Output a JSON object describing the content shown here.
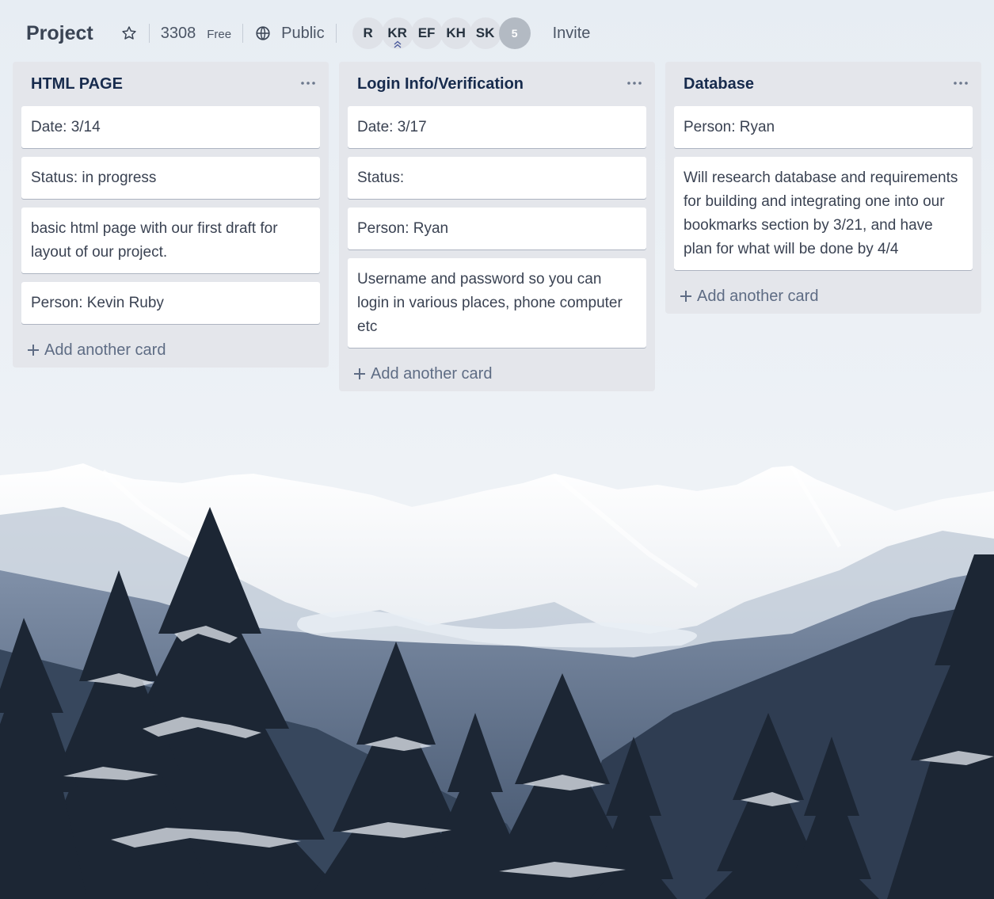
{
  "board": {
    "title": "Project",
    "team_name": "3308",
    "team_plan": "Free",
    "visibility": "Public",
    "invite_label": "Invite",
    "members": [
      "R",
      "KR",
      "EF",
      "KH",
      "SK"
    ],
    "more_members": "5"
  },
  "lists": [
    {
      "title": "HTML PAGE",
      "cards": [
        "Date: 3/14",
        "Status: in progress",
        "basic html page with our first draft for layout of our project.",
        "Person: Kevin Ruby"
      ],
      "add_label": "Add another card"
    },
    {
      "title": "Login Info/Verification",
      "cards": [
        "Date: 3/17",
        "Status:",
        "Person: Ryan",
        "Username and password so you can login in various places, phone computer etc"
      ],
      "add_label": "Add another card"
    },
    {
      "title": "Database",
      "cards": [
        "Person: Ryan",
        "Will research database and requirements for building and integrating one into our bookmarks section by 3/21, and have plan for what will be done by 4/4"
      ],
      "add_label": "Add another card"
    }
  ],
  "colors": {
    "list_bg": "#e4e6eb",
    "card_bg": "#ffffff",
    "title_text": "#172b4d",
    "snow": "#f2f5f9",
    "mountain_shadow": "#8a9bb2",
    "forest": "#1f2b3a"
  }
}
